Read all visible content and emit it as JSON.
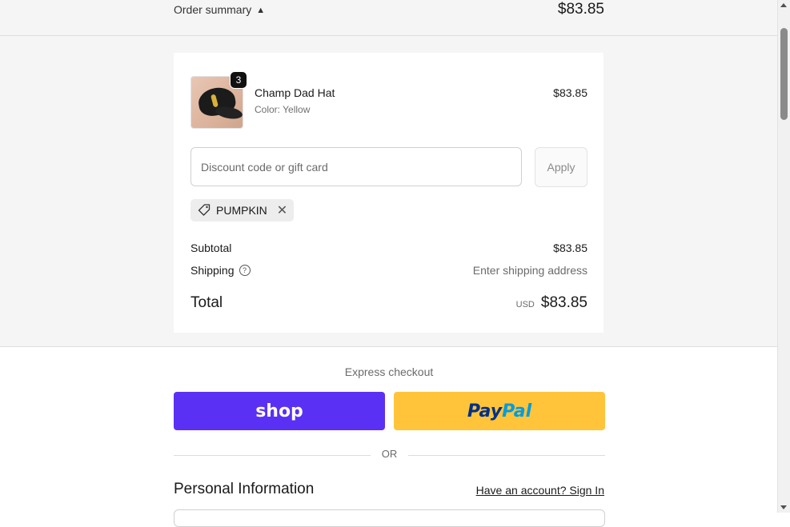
{
  "order_summary": {
    "toggle_label": "Order summary",
    "total": "$83.85"
  },
  "item": {
    "quantity": "3",
    "name": "Champ Dad Hat",
    "variant": "Color: Yellow",
    "price": "$83.85"
  },
  "discount": {
    "placeholder": "Discount code or gift card",
    "apply_label": "Apply",
    "applied_code": "PUMPKIN"
  },
  "totals": {
    "subtotal_label": "Subtotal",
    "subtotal_value": "$83.85",
    "shipping_label": "Shipping",
    "shipping_value": "Enter shipping address",
    "total_label": "Total",
    "currency": "USD",
    "total_value": "$83.85"
  },
  "express": {
    "label": "Express checkout",
    "shop_label": "shop",
    "paypal_pay": "Pay",
    "paypal_pal": "Pal",
    "or_label": "OR"
  },
  "personal": {
    "title": "Personal Information",
    "signin_link": "Have an account? Sign In"
  },
  "icons": {
    "chevron": "chevron-up-icon",
    "tag": "tag-icon",
    "close": "close-icon",
    "help": "help-circle-icon"
  }
}
